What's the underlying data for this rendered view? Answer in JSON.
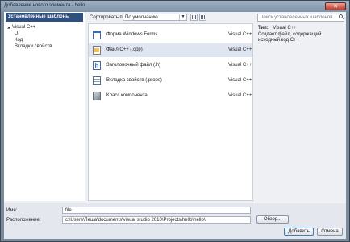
{
  "window": {
    "title": "Добавление нового элемента - hello",
    "close_glyph": "✕"
  },
  "left_panel": {
    "header": "Установленные шаблоны",
    "tree": [
      {
        "label": "Visual C++",
        "expanded": true,
        "level": 0
      },
      {
        "label": "UI",
        "level": 1
      },
      {
        "label": "Код",
        "level": 1
      },
      {
        "label": "Вкладки свойств",
        "level": 1
      }
    ]
  },
  "toolbar": {
    "sort_label": "Сортировать по:",
    "sort_value": "По умолчанию",
    "sort_arrow": "▼"
  },
  "templates": [
    {
      "name": "Форма Windows Forms",
      "type": "Visual C++",
      "icon": "windows-form-icon",
      "selected": false
    },
    {
      "name": "Файл C++ (.cpp)",
      "type": "Visual C++",
      "icon": "cpp-file-icon",
      "selected": true
    },
    {
      "name": "Заголовочный файл (.h)",
      "type": "Visual C++",
      "icon": "header-file-icon",
      "selected": false
    },
    {
      "name": "Вкладка свойств (.props)",
      "type": "Visual C++",
      "icon": "property-sheet-icon",
      "selected": false
    },
    {
      "name": "Класс компонента",
      "type": "Visual C++",
      "icon": "component-class-icon",
      "selected": false
    }
  ],
  "search": {
    "placeholder": "Поиск установленных шаблонов"
  },
  "details": {
    "type_label": "Тип:",
    "type_value": "Visual C++",
    "description": "Создает файл, содержащий исходный код C++"
  },
  "form": {
    "name_label": "Имя:",
    "name_value": "file",
    "location_label": "Расположение:",
    "location_value": "c:\\Users\\Леша\\documents\\visual studio 2010\\Projects\\hello\\hello\\",
    "browse_button": "Обзор...",
    "add_button": "Добавить",
    "cancel_button": "Отмена"
  },
  "colors": {
    "header_bg": "#2f4f7f",
    "selected_row": "#dfe6f2",
    "window_frame": "#7b8a9a"
  }
}
